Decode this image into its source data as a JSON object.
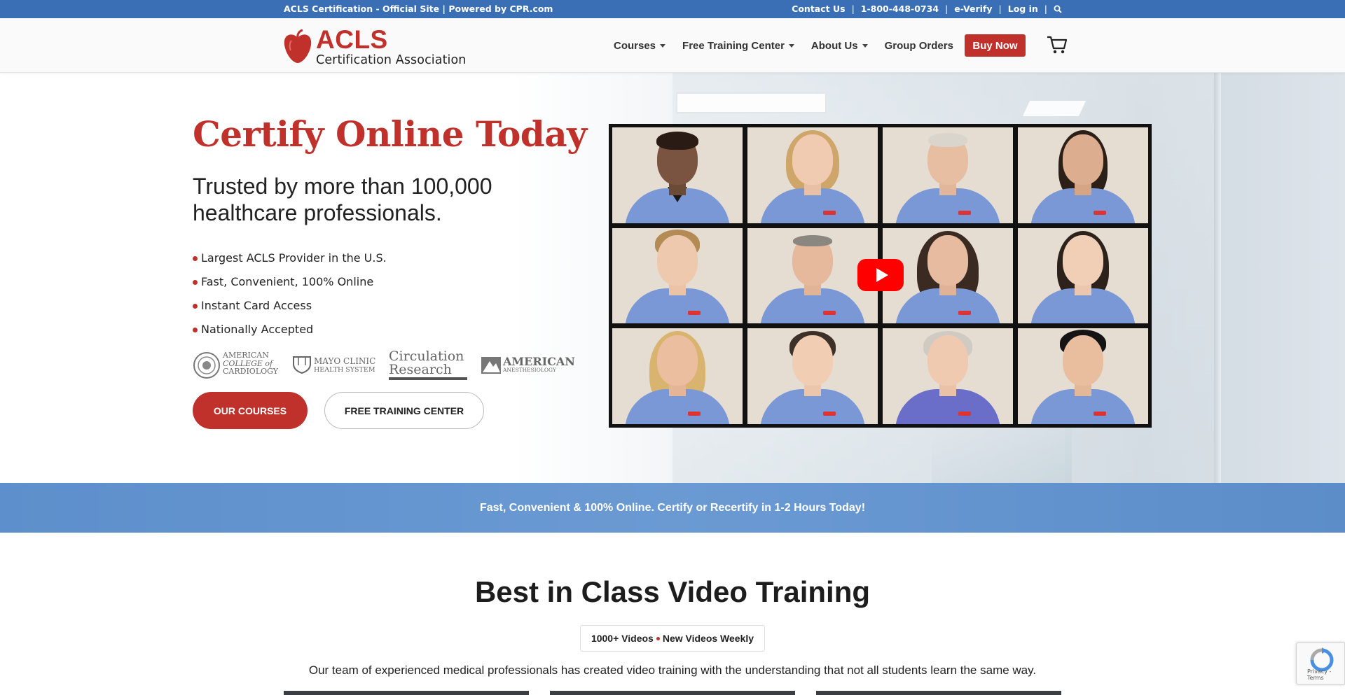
{
  "topbar": {
    "left_text": "ACLS Certification - Official Site | Powered by CPR.com",
    "links": [
      "Contact Us",
      "1-800-448-0734",
      "e-Verify",
      "Log in"
    ],
    "separator": "|"
  },
  "header": {
    "logo_big": "ACLS",
    "logo_small": "Certification Association",
    "nav": [
      {
        "label": "Courses",
        "dropdown": true
      },
      {
        "label": "Free Training Center",
        "dropdown": true
      },
      {
        "label": "About Us",
        "dropdown": true
      },
      {
        "label": "Group Orders",
        "dropdown": false
      }
    ],
    "buy_label": "Buy Now",
    "colors": {
      "brand": "#c0312b",
      "topbar": "#3a6fb5"
    }
  },
  "hero": {
    "title": "Certify Online Today",
    "subtitle": "Trusted by more than 100,000 healthcare professionals.",
    "bullets": [
      "Largest ACLS Provider in the U.S.",
      "Fast, Convenient, 100% Online",
      "Instant Card Access",
      "Nationally Accepted"
    ],
    "partners": [
      {
        "line1": "AMERICAN",
        "line2": "COLLEGE of",
        "line3": "CARDIOLOGY"
      },
      {
        "line1": "MAYO CLINIC",
        "line2": "HEALTH SYSTEM"
      },
      {
        "line1": "Circulation",
        "line2": "Research"
      },
      {
        "line1": "AMERICAN",
        "line2": "ANESTHESIOLOGY"
      }
    ],
    "btn_courses": "OUR COURSES",
    "btn_training": "FREE TRAINING CENTER"
  },
  "band_text": "Fast, Convenient & 100% Online. Certify or Recertify in 1-2 Hours Today!",
  "section": {
    "title": "Best in Class Video Training",
    "pill_a": "1000+ Videos",
    "pill_b": "New Videos Weekly",
    "description": "Our team of experienced medical professionals has created video training with the understanding that not all students learn the same way."
  },
  "recaptcha_text": "Privacy - Terms"
}
